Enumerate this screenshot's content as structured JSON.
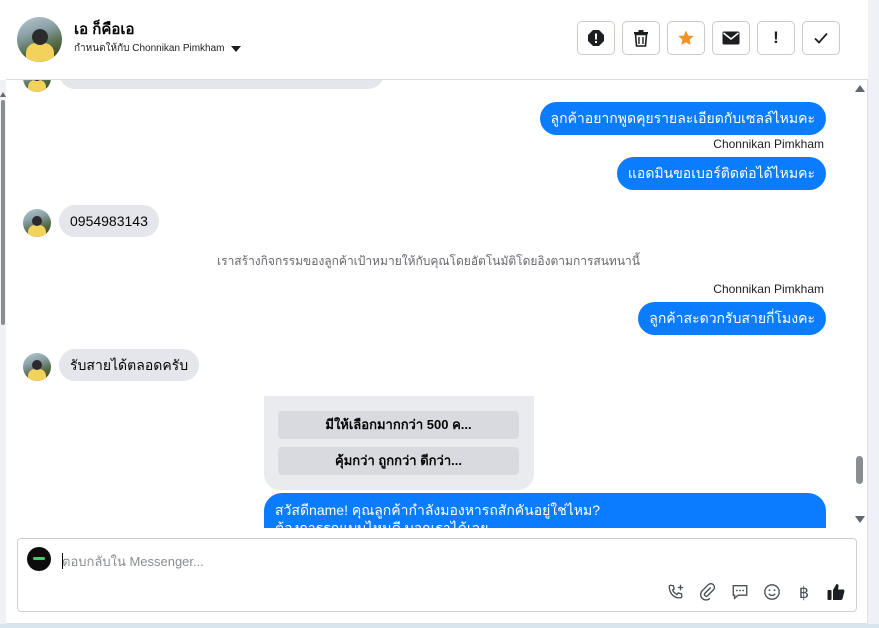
{
  "header": {
    "name": "เอ ก็คือเอ",
    "assigned_to": "กำหนดให้กับ Chonnikan Pimkham",
    "actions": [
      {
        "name": "spam-icon"
      },
      {
        "name": "trash-icon"
      },
      {
        "name": "star-icon",
        "color": "#f0932b"
      },
      {
        "name": "mail-icon"
      },
      {
        "name": "follow-up-icon",
        "glyph": "!"
      },
      {
        "name": "done-icon"
      }
    ]
  },
  "messages": {
    "out1": "ลูกค้าอยากพูดคุยรายละเอียดกับเซลล์ไหมคะ",
    "sender1": "Chonnikan Pimkham",
    "out2": "แอดมินขอเบอร์ติดต่อได้ไหมคะ",
    "in1": "0954983143",
    "system_note": "เราสร้างกิจกรรมของลูกค้าเป้าหมายให้กับคุณโดยอัตโนมัติโดยอิงตามการสนทนานี้",
    "sender2": "Chonnikan Pimkham",
    "out3": "ลูกค้าสะดวกรับสายกี่โมงคะ",
    "in2": "รับสายได้ตลอดครับ",
    "quick_replies": [
      "มีให้เลือกมากกว่า 500 ค...",
      "คุ้มกว่า ถูกกว่า ดีกว่า..."
    ],
    "out4_line1": "สวัสดีname! คุณลูกค้ากำลังมองหารถสักคันอยู่ใช่ไหม?",
    "out4_line2": "ต้องการรถแบบไหนดี บอกเราได้เลย"
  },
  "composer": {
    "placeholder": "ตอบกลับใน Messenger..."
  },
  "tools": {
    "baht_glyph": "฿"
  },
  "colors": {
    "accent": "#0a7cff",
    "incoming": "#e4e6eb"
  }
}
